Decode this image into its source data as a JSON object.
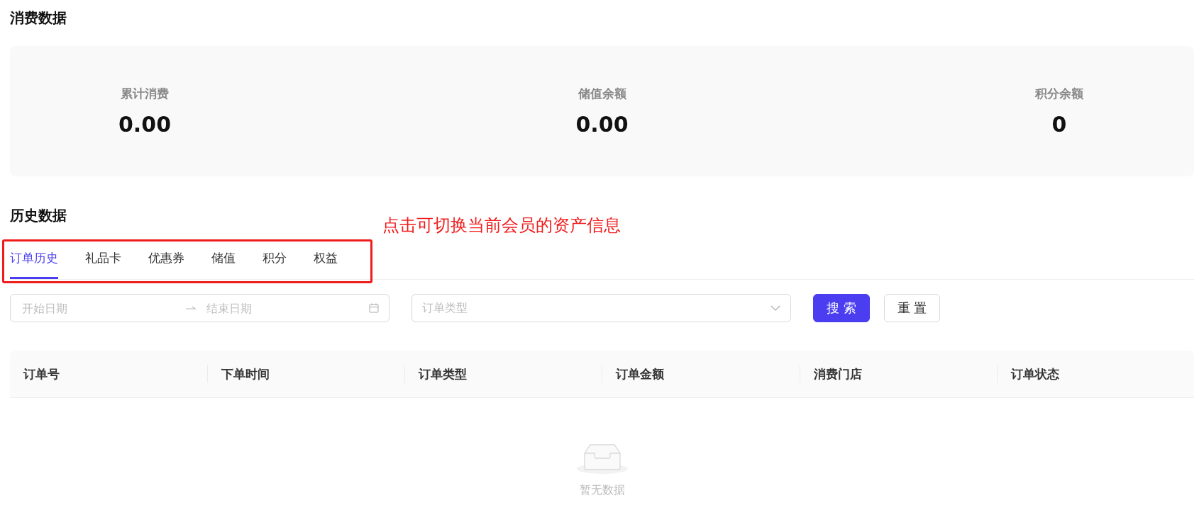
{
  "consumption": {
    "title": "消费数据",
    "stats": [
      {
        "label": "累计消费",
        "value": "0.00"
      },
      {
        "label": "储值余额",
        "value": "0.00"
      },
      {
        "label": "积分余额",
        "value": "0"
      }
    ]
  },
  "history": {
    "title": "历史数据",
    "annotation": "点击可切换当前会员的资产信息",
    "tabs": [
      {
        "label": "订单历史",
        "selected": true
      },
      {
        "label": "礼品卡",
        "selected": false
      },
      {
        "label": "优惠券",
        "selected": false
      },
      {
        "label": "储值",
        "selected": false
      },
      {
        "label": "积分",
        "selected": false
      },
      {
        "label": "权益",
        "selected": false
      }
    ],
    "filters": {
      "start_date": {
        "placeholder": "开始日期"
      },
      "end_date": {
        "placeholder": "结束日期"
      },
      "order_type": {
        "placeholder": "订单类型"
      }
    },
    "buttons": [
      {
        "label": "搜 索",
        "kind": "primary"
      },
      {
        "label": "重 置",
        "kind": "default"
      }
    ],
    "table": {
      "columns": [
        "订单号",
        "下单时间",
        "订单类型",
        "订单金额",
        "消费门店",
        "订单状态"
      ],
      "empty_text": "暂无数据"
    }
  }
}
